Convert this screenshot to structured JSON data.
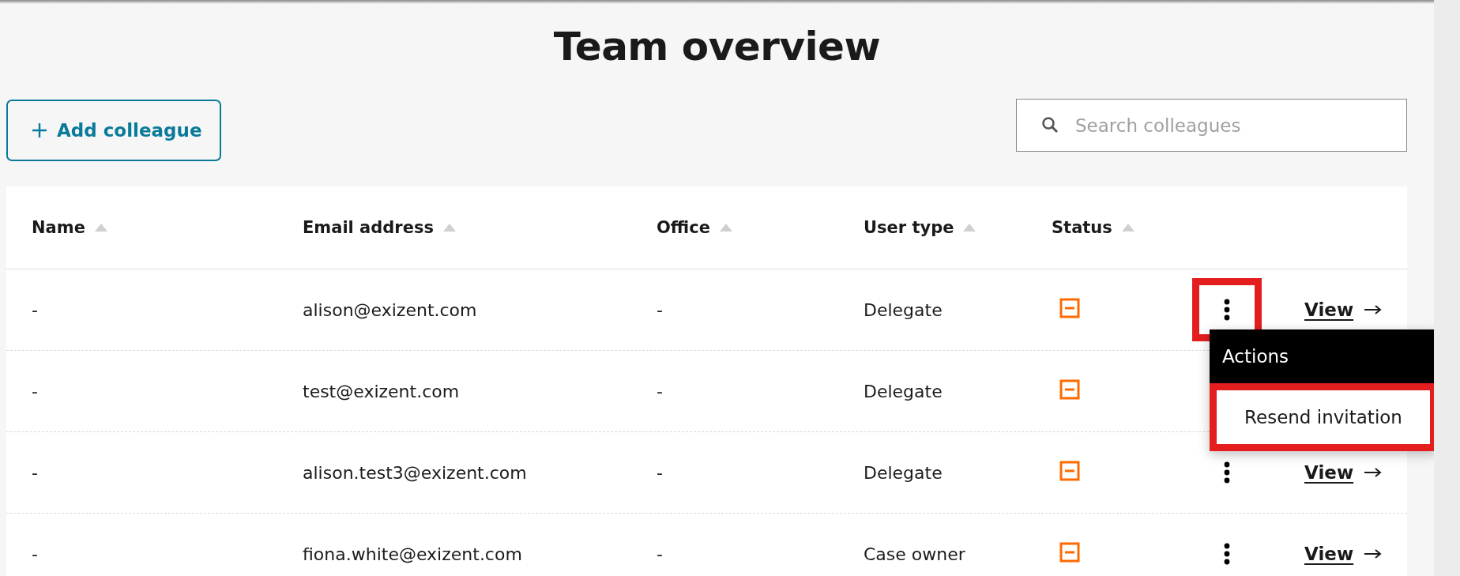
{
  "title": "Team overview",
  "add_button": {
    "label": "Add colleague"
  },
  "search": {
    "placeholder": "Search colleagues"
  },
  "table": {
    "columns": [
      {
        "label": "Name",
        "sortable": true
      },
      {
        "label": "Email address",
        "sortable": true
      },
      {
        "label": "Office",
        "sortable": true
      },
      {
        "label": "User type",
        "sortable": true
      },
      {
        "label": "Status",
        "sortable": true
      }
    ],
    "rows": [
      {
        "name": "-",
        "email": "alison@exizent.com",
        "office": "-",
        "user_type": "Delegate",
        "actions_highlighted": true,
        "view_label": "View",
        "actions_menu": {
          "title": "Actions",
          "items": [
            {
              "label": "Resend invitation",
              "highlighted": true
            }
          ]
        }
      },
      {
        "name": "-",
        "email": "test@exizent.com",
        "office": "-",
        "user_type": "Delegate"
      },
      {
        "name": "-",
        "email": "alison.test3@exizent.com",
        "office": "-",
        "user_type": "Delegate",
        "actions_highlighted": false,
        "view_label": "View"
      },
      {
        "name": "-",
        "email": "fiona.white@exizent.com",
        "office": "-",
        "user_type": "Case owner",
        "actions_highlighted": false,
        "view_label": "View"
      }
    ]
  }
}
